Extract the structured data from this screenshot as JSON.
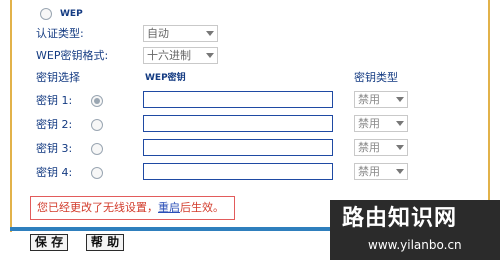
{
  "wep": {
    "label": "WEP"
  },
  "auth": {
    "label": "认证类型:",
    "value": "自动"
  },
  "key_format": {
    "label": "WEP密钥格式:",
    "value": "十六进制"
  },
  "headers": {
    "key_select": "密钥选择",
    "wep_key": "WEP密钥",
    "key_type": "密钥类型"
  },
  "keys": [
    {
      "label": "密钥 1:",
      "type": "禁用",
      "selected": true
    },
    {
      "label": "密钥 2:",
      "type": "禁用",
      "selected": false
    },
    {
      "label": "密钥 3:",
      "type": "禁用",
      "selected": false
    },
    {
      "label": "密钥 4:",
      "type": "禁用",
      "selected": false
    }
  ],
  "notice": {
    "prefix": "您已经更改了无线设置，",
    "link": "重启",
    "suffix": "后生效。"
  },
  "buttons": {
    "save": "保 存",
    "help": "帮 助"
  },
  "watermark": {
    "title": "路由知识网",
    "url": "www.yilanbo.cn"
  }
}
